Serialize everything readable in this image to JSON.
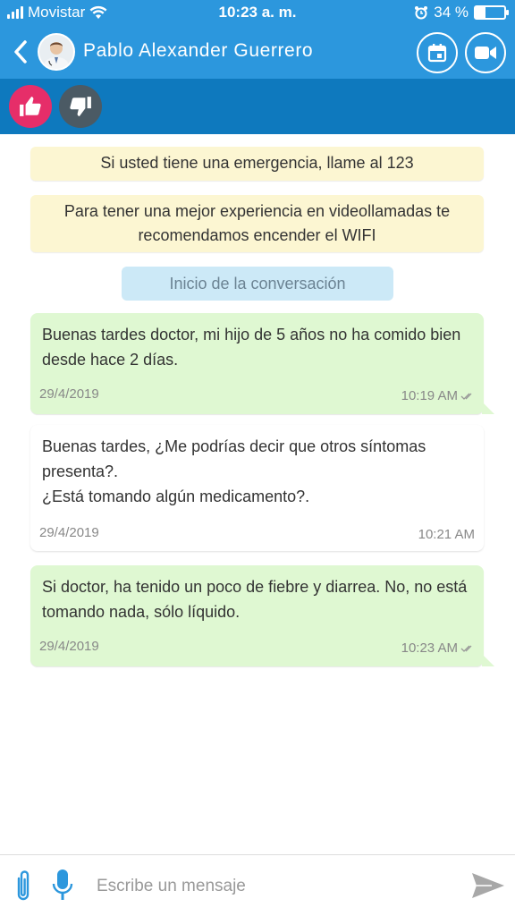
{
  "status_bar": {
    "carrier": "Movistar",
    "time": "10:23 a. m.",
    "battery": "34 %",
    "battery_level": 0.34
  },
  "header": {
    "contact_name": "Pablo Alexander Guerrero"
  },
  "notices": {
    "emergency": "Si usted tiene una emergencia, llame al 123",
    "wifi": "Para tener una mejor experiencia en videollamadas te recomendamos encender el WIFI",
    "conversation_start": "Inicio de la conversación"
  },
  "messages": [
    {
      "direction": "sent",
      "text": "Buenas tardes doctor, mi hijo de 5 años no ha comido bien desde hace 2 días.",
      "date": "29/4/2019",
      "time": "10:19 AM"
    },
    {
      "direction": "received",
      "text": "Buenas tardes, ¿Me podrías decir que otros síntomas presenta?.\n¿Está tomando algún medicamento?.",
      "date": "29/4/2019",
      "time": "10:21 AM"
    },
    {
      "direction": "sent",
      "text": "Si doctor, ha tenido un poco de fiebre y diarrea. No, no está tomando nada, sólo líquido.",
      "date": "29/4/2019",
      "time": "10:23 AM"
    }
  ],
  "input": {
    "placeholder": "Escribe un mensaje",
    "value": ""
  },
  "colors": {
    "header_blue": "#2c97dd",
    "rating_bar_blue": "#0e79be",
    "like_pink": "#e62e69",
    "dislike_gray": "#4b5a64",
    "sent_bubble": "#dff8d2",
    "notice_yellow": "#fcf6d2",
    "conv_start_blue": "#cce9f7"
  },
  "icons": {
    "back": "chevron-left-icon",
    "calendar": "calendar-icon",
    "video": "video-camera-icon",
    "like": "thumbs-up-icon",
    "dislike": "thumbs-down-icon",
    "attach": "paperclip-icon",
    "mic": "microphone-icon",
    "send": "send-icon",
    "read": "double-check-icon"
  }
}
